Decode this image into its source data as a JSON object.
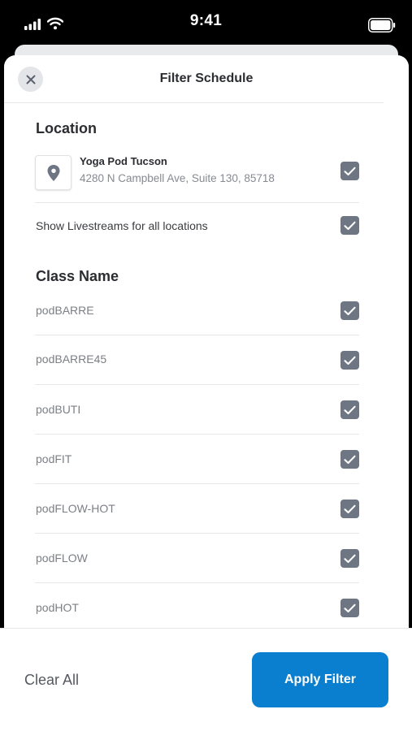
{
  "status_bar": {
    "time": "9:41"
  },
  "header": {
    "title": "Filter Schedule"
  },
  "location_section": {
    "title": "Location",
    "location": {
      "name": "Yoga Pod Tucson",
      "address": "4280 N Campbell Ave, Suite 130, 85718",
      "checked": true
    },
    "livestream": {
      "label": "Show Livestreams for all locations",
      "checked": true
    }
  },
  "class_section": {
    "title": "Class Name",
    "items": [
      {
        "label": "podBARRE",
        "checked": true
      },
      {
        "label": "podBARRE45",
        "checked": true
      },
      {
        "label": "podBUTI",
        "checked": true
      },
      {
        "label": "podFIT",
        "checked": true
      },
      {
        "label": "podFLOW-HOT",
        "checked": true
      },
      {
        "label": "podFLOW",
        "checked": true
      },
      {
        "label": "podHOT",
        "checked": true
      }
    ]
  },
  "footer": {
    "clear_label": "Clear All",
    "apply_label": "Apply Filter"
  },
  "colors": {
    "accent": "#0a7fd0",
    "checkbox": "#6e7684",
    "muted_text": "#7b7f86"
  }
}
